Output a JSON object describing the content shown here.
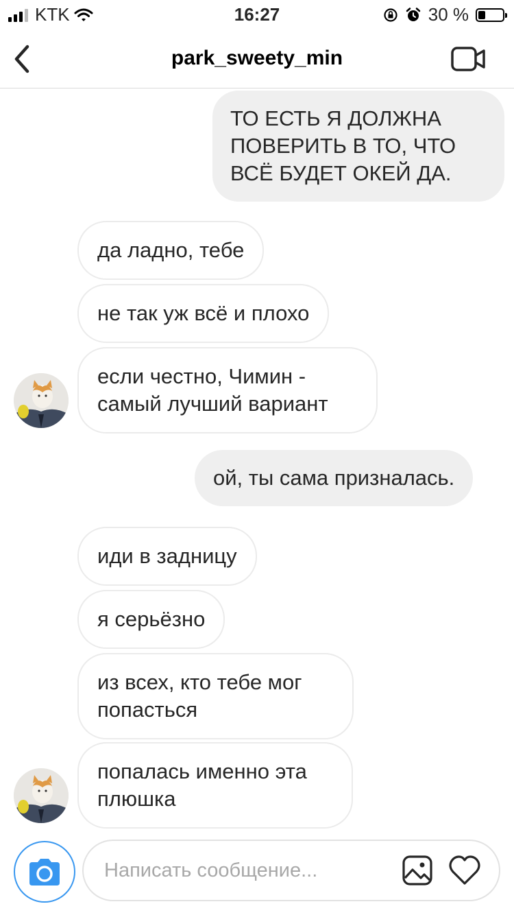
{
  "status_bar": {
    "carrier": "KTK",
    "time": "16:27",
    "battery": "30 %",
    "battery_level": 0.3
  },
  "header": {
    "title": "park_sweety_min",
    "back_icon": "chevron-left-icon",
    "video_icon": "video-camera-icon"
  },
  "messages": [
    {
      "direction": "outgoing",
      "text": "ТО ЕСТЬ Я ДОЛЖНА ПОВЕРИТЬ В ТО, ЧТО ВСЁ БУДЕТ ОКЕЙ ДА."
    },
    {
      "direction": "incoming",
      "text": "да ладно, тебе"
    },
    {
      "direction": "incoming",
      "text": "не так уж всё и плохо"
    },
    {
      "direction": "incoming",
      "text": "если честно, Чимин - самый лучший вариант"
    },
    {
      "direction": "outgoing",
      "text": "ой, ты сама призналась."
    },
    {
      "direction": "incoming",
      "text": "иди в задницу"
    },
    {
      "direction": "incoming",
      "text": "я серьёзно"
    },
    {
      "direction": "incoming",
      "text": "из всех, кто тебе мог попасться"
    },
    {
      "direction": "incoming",
      "text": "попалась именно эта плюшка"
    }
  ],
  "composer": {
    "placeholder": "Написать сообщение...",
    "camera_icon": "camera-icon",
    "gallery_icon": "gallery-icon",
    "like_icon": "heart-icon",
    "accent": "#3897f0"
  }
}
